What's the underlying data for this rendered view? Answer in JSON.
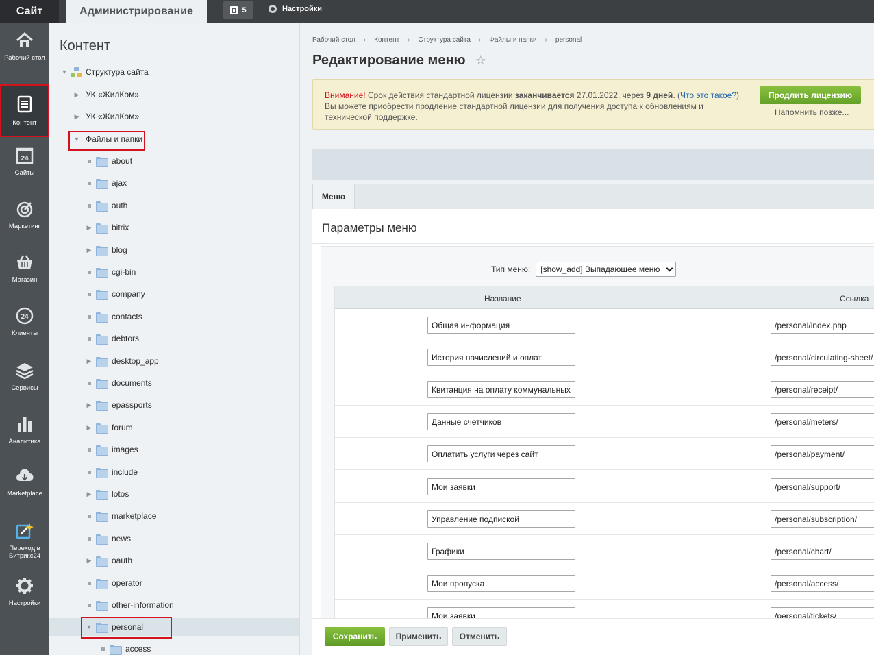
{
  "topbar": {
    "site": "Сайт",
    "admin": "Администрирование",
    "notifications": "5",
    "settings": "Настройки"
  },
  "leftmenu": {
    "items": [
      {
        "label": "Рабочий стол",
        "icon": "home-icon"
      },
      {
        "label": "Контент",
        "icon": "document-icon"
      },
      {
        "label": "Сайты",
        "icon": "calendar-24-icon"
      },
      {
        "label": "Маркетинг",
        "icon": "target-icon"
      },
      {
        "label": "Магазин",
        "icon": "basket-icon"
      },
      {
        "label": "Клиенты",
        "icon": "clients-24-icon"
      },
      {
        "label": "Сервисы",
        "icon": "layers-icon"
      },
      {
        "label": "Аналитика",
        "icon": "bar-chart-icon"
      },
      {
        "label": "Marketplace",
        "icon": "cloud-download-icon"
      },
      {
        "label": "Переход в Битрикс24",
        "icon": "bitrix24-go-icon"
      },
      {
        "label": "Настройки",
        "icon": "gear-icon"
      }
    ]
  },
  "tree": {
    "title": "Контент",
    "root": "Структура сайта",
    "sites": [
      "УК «ЖилКом»",
      "УК «ЖилКом»"
    ],
    "files_node": "Файлы и папки",
    "folders": [
      {
        "name": "about",
        "expandable": false
      },
      {
        "name": "ajax",
        "expandable": false
      },
      {
        "name": "auth",
        "expandable": false
      },
      {
        "name": "bitrix",
        "expandable": true
      },
      {
        "name": "blog",
        "expandable": true
      },
      {
        "name": "cgi-bin",
        "expandable": false
      },
      {
        "name": "company",
        "expandable": false
      },
      {
        "name": "contacts",
        "expandable": false
      },
      {
        "name": "debtors",
        "expandable": false
      },
      {
        "name": "desktop_app",
        "expandable": true
      },
      {
        "name": "documents",
        "expandable": false
      },
      {
        "name": "epassports",
        "expandable": true
      },
      {
        "name": "forum",
        "expandable": true
      },
      {
        "name": "images",
        "expandable": false
      },
      {
        "name": "include",
        "expandable": false
      },
      {
        "name": "lotos",
        "expandable": true
      },
      {
        "name": "marketplace",
        "expandable": false
      },
      {
        "name": "news",
        "expandable": false
      },
      {
        "name": "oauth",
        "expandable": true
      },
      {
        "name": "operator",
        "expandable": false
      },
      {
        "name": "other-information",
        "expandable": false
      },
      {
        "name": "personal",
        "expandable": true,
        "expanded": true
      }
    ],
    "subfolder": "access"
  },
  "breadcrumb": [
    "Рабочий стол",
    "Контент",
    "Структура сайта",
    "Файлы и папки",
    "personal"
  ],
  "page": {
    "title": "Редактирование меню"
  },
  "notice": {
    "warning": "Внимание!",
    "text1": " Срок действия стандартной лицензии ",
    "bold1": "заканчивается",
    "text2": " 27.01.2022, через ",
    "bold2": "9 дней",
    "text3": ". (",
    "link": "Что это такое?",
    "text4": ")",
    "line2": "Вы можете приобрести продление стандартной лицензии для получения доступа к обновлениям и технической поддержке.",
    "extend_button": "Продлить лицензию",
    "remind_link": "Напомнить позже..."
  },
  "tabs": {
    "menu": "Меню"
  },
  "form": {
    "section_title": "Параметры меню",
    "type_label": "Тип меню:",
    "type_value": "[show_add] Выпадающее меню",
    "col_name": "Название",
    "col_link": "Ссылка",
    "rows": [
      {
        "name": "Общая информация",
        "link": "/personal/index.php"
      },
      {
        "name": "История начислений и оплат",
        "link": "/personal/circulating-sheet/"
      },
      {
        "name": "Квитанция на оплату коммунальных у",
        "link": "/personal/receipt/"
      },
      {
        "name": "Данные счетчиков",
        "link": "/personal/meters/"
      },
      {
        "name": "Оплатить услуги через сайт",
        "link": "/personal/payment/"
      },
      {
        "name": "Мои заявки",
        "link": "/personal/support/"
      },
      {
        "name": "Управление подпиской",
        "link": "/personal/subscription/"
      },
      {
        "name": "Графики",
        "link": "/personal/chart/"
      },
      {
        "name": "Мои пропуска",
        "link": "/personal/access/"
      },
      {
        "name": "Мои заявки",
        "link": "/personal/tickets/"
      }
    ]
  },
  "footer": {
    "save": "Сохранить",
    "apply": "Применить",
    "cancel": "Отменить"
  },
  "colors": {
    "accent_green": "#6fab30",
    "highlight_red": "#d2121c",
    "sidebar": "#4c5156",
    "topbar": "#3d4043"
  }
}
